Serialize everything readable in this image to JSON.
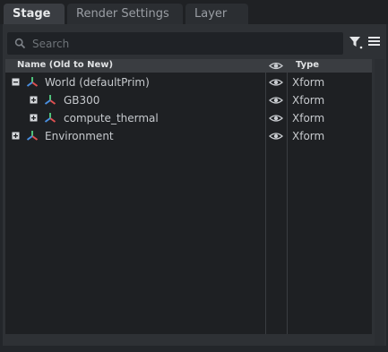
{
  "tabs": [
    {
      "label": "Stage",
      "active": true
    },
    {
      "label": "Render Settings",
      "active": false
    },
    {
      "label": "Layer",
      "active": false
    }
  ],
  "search": {
    "placeholder": "Search",
    "value": ""
  },
  "columns": {
    "name": "Name (Old to New)",
    "visibility": "eye-icon",
    "type": "Type"
  },
  "rows": [
    {
      "name": "World (defaultPrim)",
      "type": "Xform",
      "expander": "minus",
      "depth": 0
    },
    {
      "name": "GB300",
      "type": "Xform",
      "expander": "plus",
      "depth": 1
    },
    {
      "name": "compute_thermal",
      "type": "Xform",
      "expander": "plus",
      "depth": 1
    },
    {
      "name": "Environment",
      "type": "Xform",
      "expander": "plus",
      "depth": 0
    }
  ],
  "colors": {
    "prim_x": "#e05050",
    "prim_y": "#4ec27a",
    "prim_z": "#4a8fe0"
  }
}
